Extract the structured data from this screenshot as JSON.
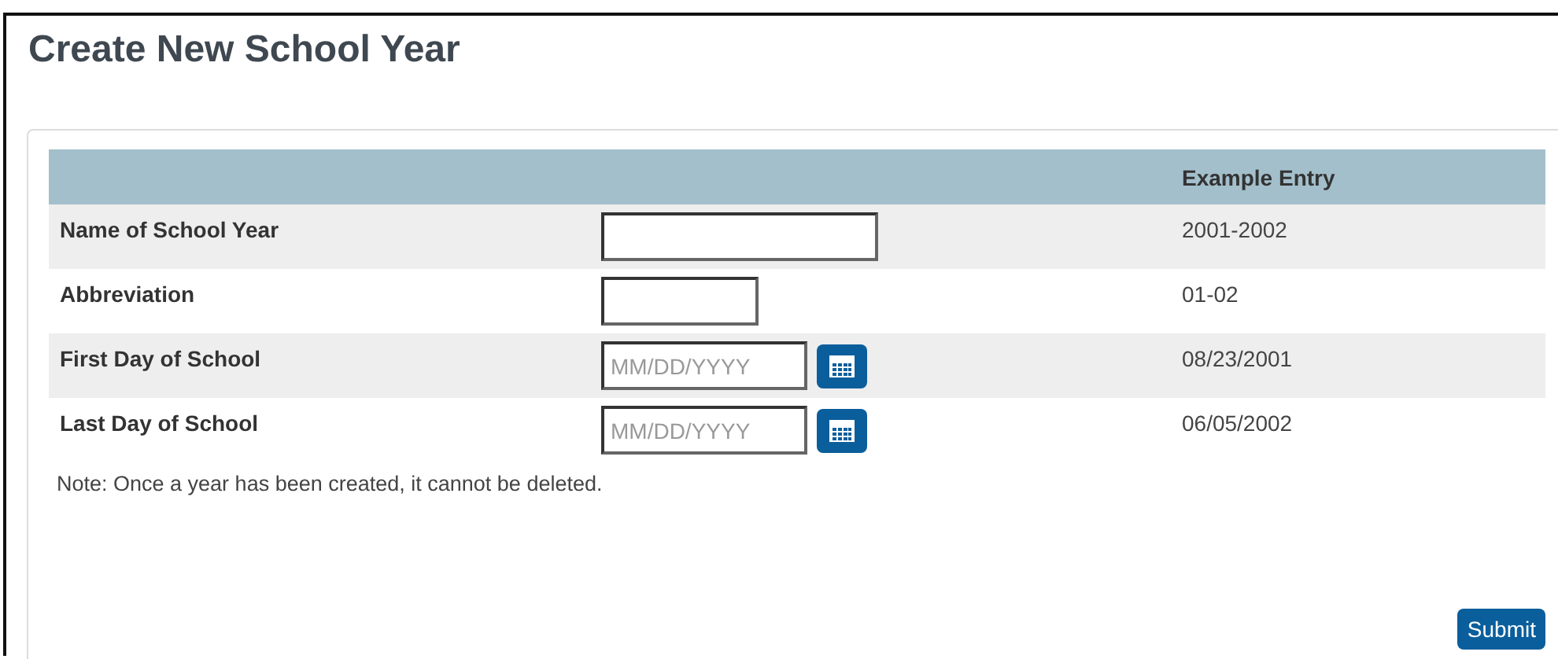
{
  "title": "Create New School Year",
  "table": {
    "example_header": "Example Entry",
    "rows": [
      {
        "label": "Name of School Year",
        "kind": "text-wide",
        "example": "2001-2002"
      },
      {
        "label": "Abbreviation",
        "kind": "text-narrow",
        "example": "01-02"
      },
      {
        "label": "First Day of School",
        "kind": "date",
        "placeholder": "MM/DD/YYYY",
        "example": "08/23/2001"
      },
      {
        "label": "Last Day of School",
        "kind": "date",
        "placeholder": "MM/DD/YYYY",
        "example": "06/05/2002"
      }
    ]
  },
  "note": "Note: Once a year has been created, it cannot be deleted.",
  "submit": "Submit"
}
